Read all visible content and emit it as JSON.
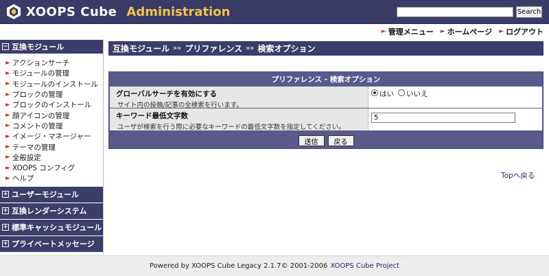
{
  "header": {
    "logo_text": "XOOPS Cube",
    "title": "Administration",
    "search_placeholder": "",
    "search_button": "Search"
  },
  "topnav": [
    "管理メニュー",
    "ホームページ",
    "ログアウト"
  ],
  "sidebar": {
    "section_open": "互換モジュール",
    "items": [
      "アクションサーチ",
      "モジュールの管理",
      "モジュールのインストール",
      "ブロックの管理",
      "ブロックのインストール",
      "顔アイコンの管理",
      "コメントの管理",
      "イメージ・マネージャー",
      "テーマの管理",
      "全般設定",
      "XOOPS コンフィグ",
      "ヘルプ"
    ],
    "collapsed_sections": [
      "ユーザーモジュール",
      "互換レンダーシステム",
      "標準キャッシュモジュール",
      "プライベートメッセージ"
    ]
  },
  "breadcrumb": {
    "items": [
      "互換モジュール",
      "プリファレンス",
      "検索オプション"
    ],
    "separator": "»»"
  },
  "form": {
    "title": "プリファレンス - 検索オプション",
    "global_search": {
      "label": "グローバルサーチを有効にする",
      "desc": "サイト内の投稿/記事の全検索を行います。",
      "options": [
        "はい",
        "いいえ"
      ],
      "selected": "はい"
    },
    "min_keyword": {
      "label": "キーワード最低文字数",
      "desc": "ユーザが検索を行う際に必要なキーワードの最低文字数を指定してください。",
      "value": "5"
    },
    "submit": "送信",
    "back": "戻る"
  },
  "top_link": "Topへ戻る",
  "footer": {
    "text": "Powered by XOOPS Cube Legacy 2.1.7© 2001-2006",
    "link": "XOOPS Cube Project"
  }
}
